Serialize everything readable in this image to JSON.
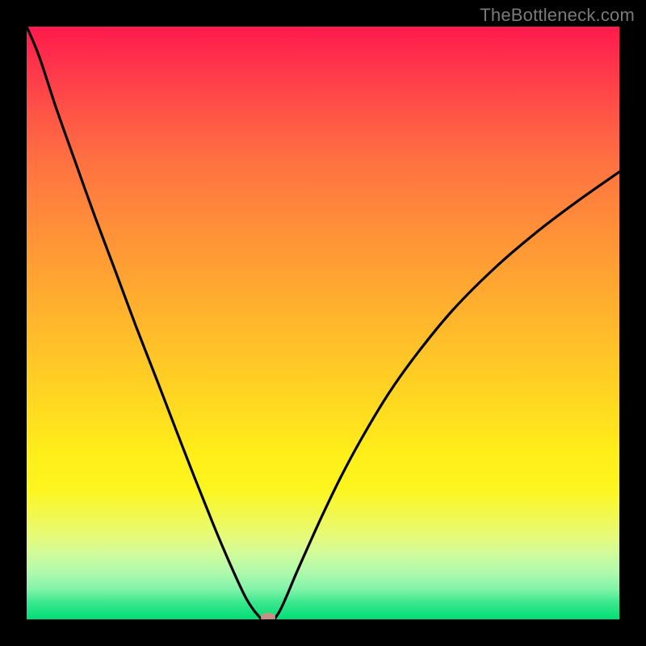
{
  "watermark": {
    "text": "TheBottleneck.com"
  },
  "chart_data": {
    "type": "line",
    "title": "",
    "xlabel": "",
    "ylabel": "",
    "xlim": [
      0,
      100
    ],
    "ylim": [
      0,
      100
    ],
    "gradient_stops": [
      {
        "pos": 0,
        "color": "#ff1a4d"
      },
      {
        "pos": 72,
        "color": "#ffee1a"
      },
      {
        "pos": 100,
        "color": "#00dd75"
      }
    ],
    "series": [
      {
        "name": "left-branch",
        "x": [
          0.0,
          2.1,
          4.9,
          8.2,
          11.5,
          15.0,
          18.5,
          22.2,
          25.0,
          28.3,
          31.5,
          33.6,
          35.6,
          37.0,
          38.2,
          39.1,
          39.5,
          39.6
        ],
        "y": [
          100.0,
          95.0,
          86.5,
          77.2,
          68.0,
          58.7,
          49.3,
          39.8,
          32.5,
          24.0,
          16.0,
          11.0,
          6.5,
          3.6,
          1.7,
          0.6,
          0.15,
          0.0
        ]
      },
      {
        "name": "right-branch",
        "x": [
          41.8,
          42.0,
          42.8,
          43.9,
          45.5,
          47.5,
          50.0,
          53.0,
          56.5,
          61.0,
          66.0,
          72.0,
          79.0,
          86.0,
          93.0,
          100.0
        ],
        "y": [
          0.0,
          0.3,
          1.6,
          4.0,
          7.8,
          12.3,
          17.8,
          24.0,
          30.5,
          38.0,
          45.0,
          52.3,
          59.3,
          65.3,
          70.6,
          75.5
        ]
      }
    ],
    "markers": [
      {
        "name": "minimum-marker",
        "x": 40.7,
        "y": 0.0,
        "color": "#d88a87"
      }
    ]
  }
}
